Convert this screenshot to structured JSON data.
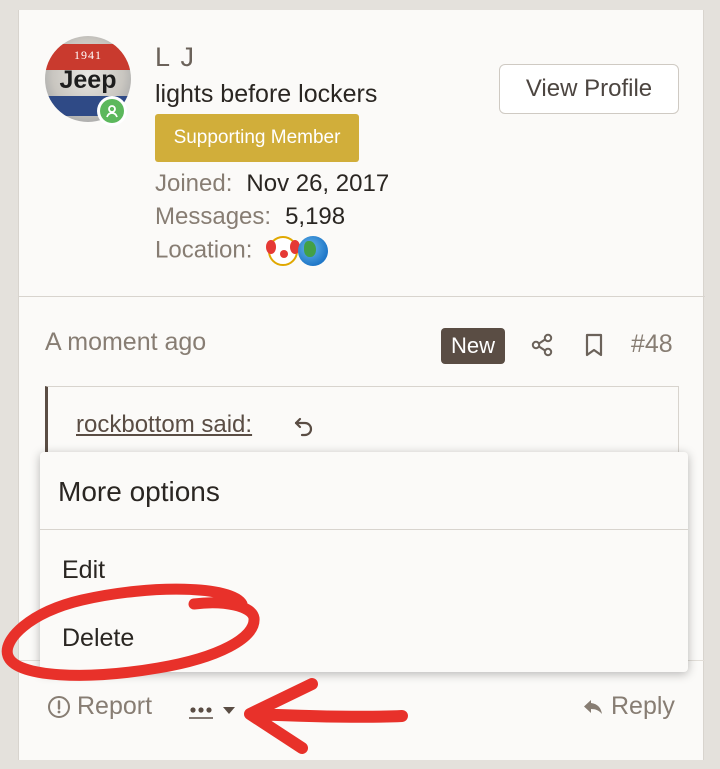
{
  "profile": {
    "avatar_text_top": "1941",
    "avatar_text_main": "Jeep",
    "username": "L J",
    "user_title": "lights before lockers",
    "badge": "Supporting Member",
    "view_profile": "View Profile",
    "joined_label": "Joined:",
    "joined_value": "Nov 26, 2017",
    "messages_label": "Messages:",
    "messages_value": "5,198",
    "location_label": "Location:",
    "location_icons": [
      "clown-face-emoji",
      "globe-emoji"
    ]
  },
  "post": {
    "timestamp": "A moment ago",
    "new_badge": "New",
    "post_number": "#48",
    "quote_author": "rockbottom said:"
  },
  "menu": {
    "title": "More options",
    "items": [
      "Edit",
      "Delete"
    ]
  },
  "footer": {
    "report_label": "Report",
    "more_label": "•••",
    "reply_label": "Reply"
  },
  "colors": {
    "badge": "#d1ae3a",
    "new_badge": "#5a4d44",
    "annotation": "#e8312a",
    "online": "#5cb85c"
  }
}
